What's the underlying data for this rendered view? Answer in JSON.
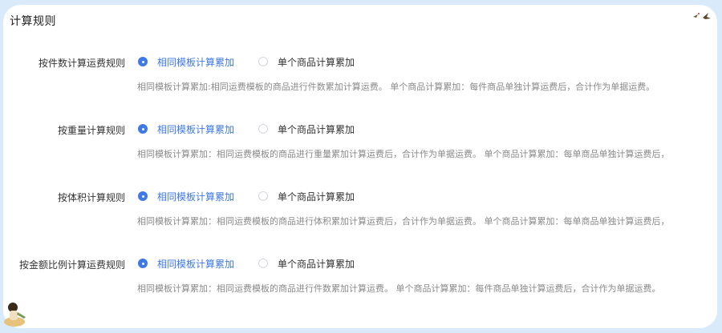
{
  "section": {
    "title": "计算规则"
  },
  "colors": {
    "accent": "#3e79e8",
    "muted": "#8a8a8a",
    "frame": "#d9ebfb"
  },
  "rules": [
    {
      "label": "按件数计算运费规则",
      "option_a": "相同模板计算累加",
      "option_b": "单个商品计算累加",
      "selected": "option_a",
      "description": "相同模板计算累加:相同运费模板的商品进行件数累加计算运费。 单个商品计算累加：每件商品单独计算运费后，合计作为单据运费。"
    },
    {
      "label": "按重量计算规则",
      "option_a": "相同模板计算累加",
      "option_b": "单个商品计算累加",
      "selected": "option_a",
      "description": "相同模板计算累加：相同运费模板的商品进行重量累加计算运费后，合计作为单据运费。 单个商品计算累加：每单商品单独计算运费后，"
    },
    {
      "label": "按体积计算规则",
      "option_a": "相同模板计算累加",
      "option_b": "单个商品计算累加",
      "selected": "option_a",
      "description": "相同模板计算累加：相同运费模板的商品进行体积累加计算运费后，合计作为单据运费。 单个商品计算累加：每单商品单独计算运费后，"
    },
    {
      "label": "按金额比例计算运费规则",
      "option_a": "相同模板计算累加",
      "option_b": "单个商品计算累加",
      "selected": "option_a",
      "description": "相同模板计算累加：相同运费模板的商品进行件数累加计算运费。 单个商品计算累加：每件商品单独计算运费后，合计作为单据运费。"
    }
  ]
}
